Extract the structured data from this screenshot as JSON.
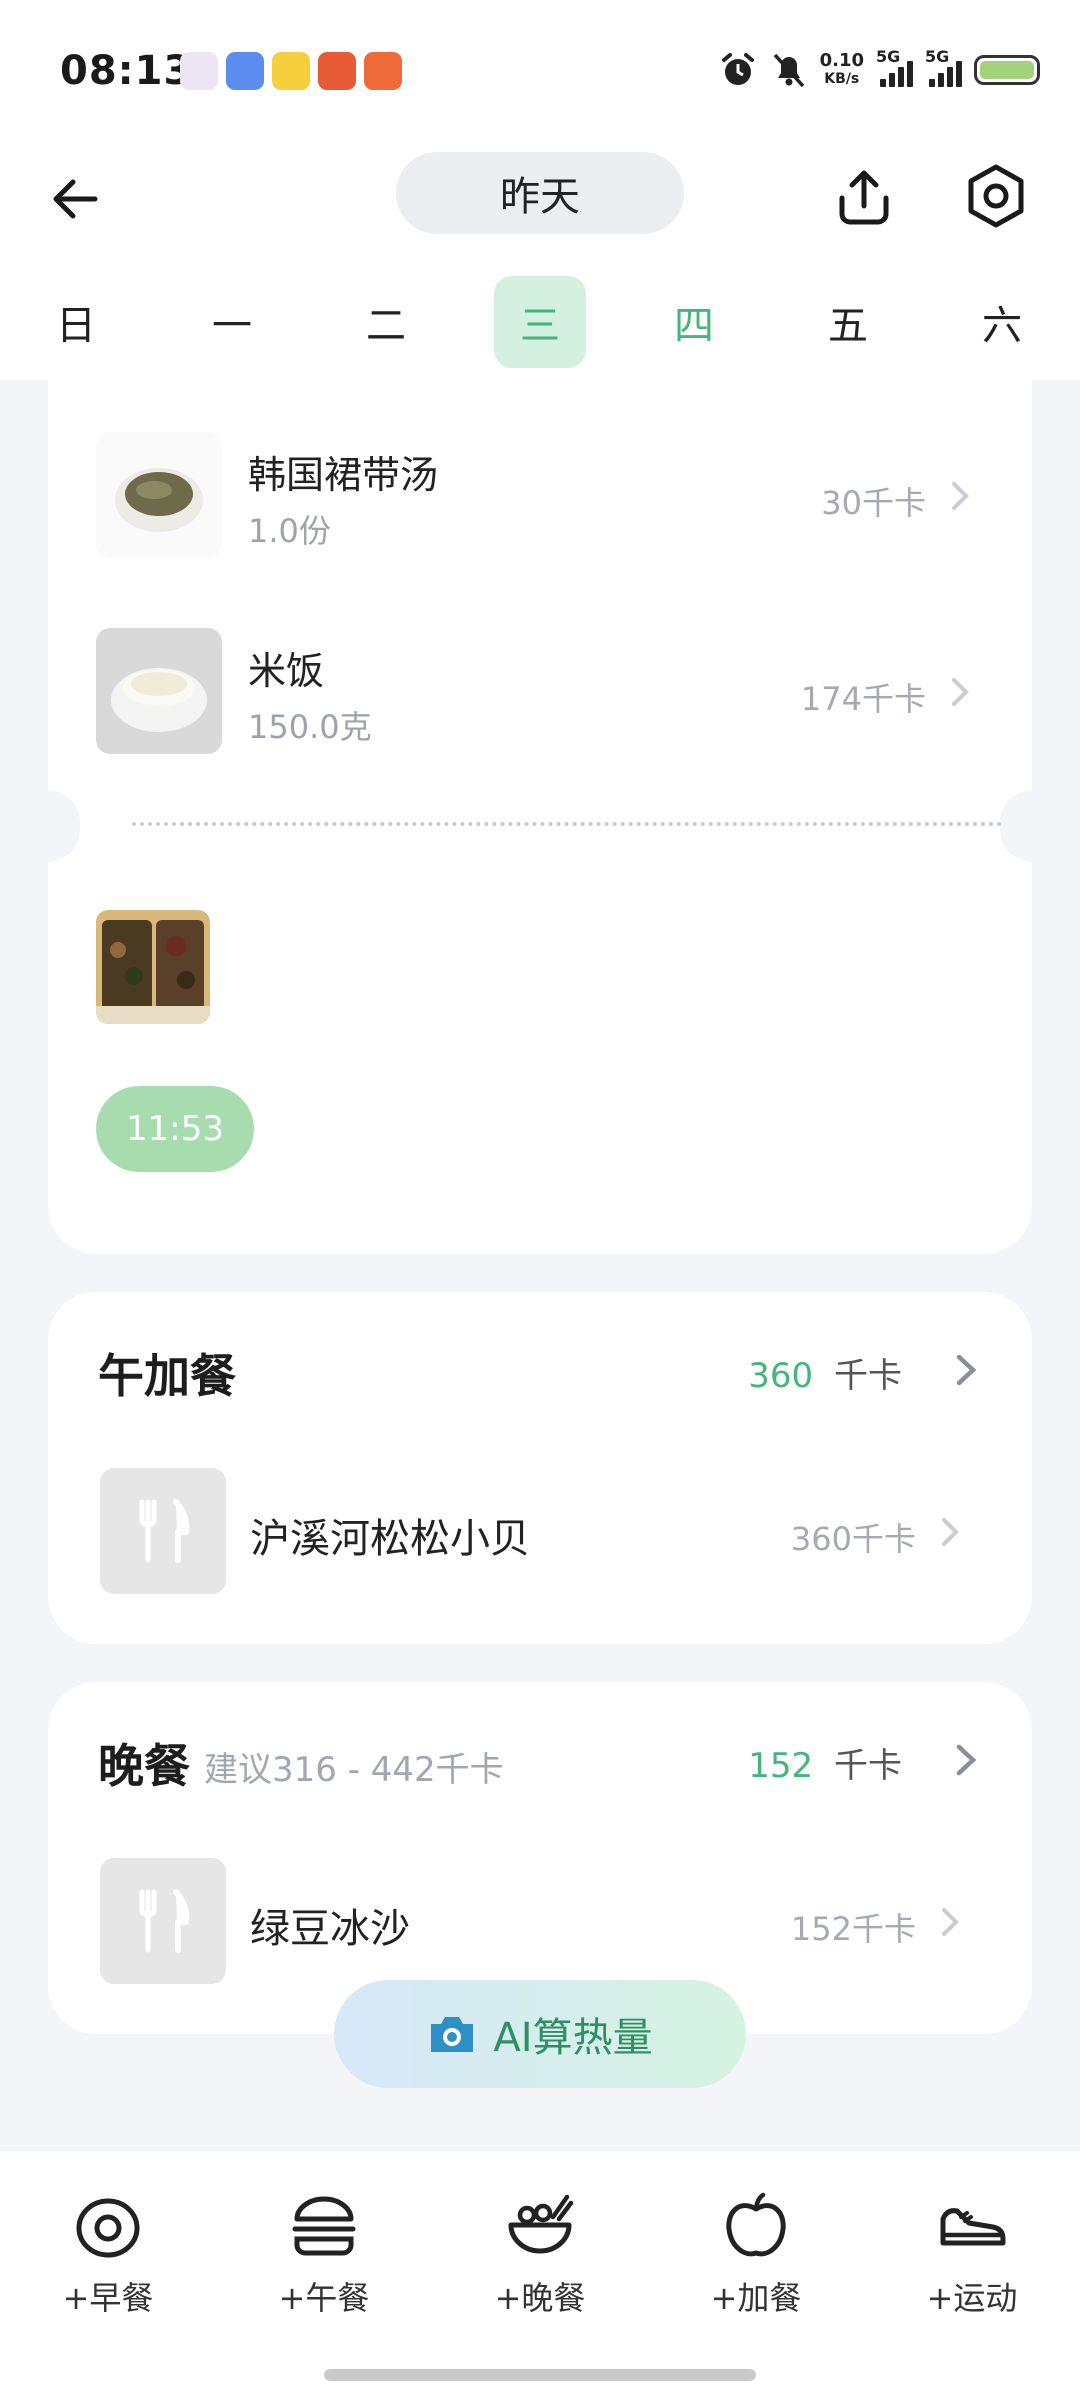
{
  "status_bar": {
    "time": "08:13",
    "net_speed_value": "0.10",
    "net_speed_unit": "KB/s",
    "sim1_label": "5G",
    "sim2_label": "5G",
    "app_icons": [
      "app-icon-1",
      "app-icon-2",
      "app-icon-3",
      "app-icon-4",
      "app-icon-5"
    ],
    "app_colors": [
      "#e8e0f0",
      "#5b8def",
      "#f5cf3c",
      "#e65a36",
      "#f06b3a"
    ]
  },
  "header": {
    "date_label": "昨天",
    "icons": {
      "back": "arrow-left-icon",
      "share": "share-upload-icon",
      "settings": "settings-ring-icon"
    }
  },
  "week": {
    "days": [
      "日",
      "一",
      "二",
      "三",
      "四",
      "五",
      "六"
    ],
    "selected_index": 3,
    "today_index": 4
  },
  "lunch_card": {
    "items": [
      {
        "name": "韩国裙带汤",
        "amount": "1.0份",
        "calories": "30千卡"
      },
      {
        "name": "米饭",
        "amount": "150.0克",
        "calories": "174千卡"
      }
    ],
    "record_time": "11:53"
  },
  "afternoon_snack": {
    "title": "午加餐",
    "kcal": "360",
    "unit": "千卡",
    "item": {
      "name": "沪溪河松松小贝",
      "calories": "360千卡"
    }
  },
  "dinner": {
    "title": "晚餐",
    "suggestion": "建议316 - 442千卡",
    "kcal": "152",
    "unit": "千卡",
    "item": {
      "name": "绿豆冰沙",
      "calories": "152千卡"
    }
  },
  "ai_button": {
    "label": "AI算热量",
    "icon": "camera-icon"
  },
  "bottom_nav": {
    "items": [
      {
        "label": "+早餐",
        "icon": "egg-icon"
      },
      {
        "label": "+午餐",
        "icon": "burger-icon"
      },
      {
        "label": "+晚餐",
        "icon": "bowl-icon"
      },
      {
        "label": "+加餐",
        "icon": "apple-icon"
      },
      {
        "label": "+运动",
        "icon": "sneaker-icon"
      }
    ]
  },
  "colors": {
    "accent_green": "#45b67a",
    "selected_day_bg": "#d4f0e0",
    "time_pill": "#a7dcaf",
    "background": "#f3f5f8"
  }
}
